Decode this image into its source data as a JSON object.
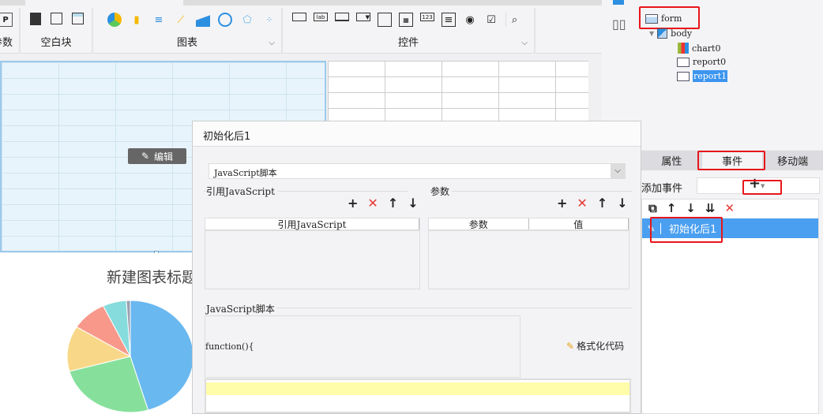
{
  "toolbar": {
    "groups": [
      {
        "label": "参数"
      },
      {
        "label": "空白块"
      },
      {
        "label": "图表"
      },
      {
        "label": "控件"
      }
    ],
    "param_icon": "P"
  },
  "canvas": {
    "edit_button": "编辑",
    "chart_title": "新建图表标题"
  },
  "pie": {
    "slices": [
      {
        "value": 45,
        "color": "#6ab8f0"
      },
      {
        "value": 25,
        "color": "#86e09c"
      },
      {
        "value": 13,
        "color": "#f8d888"
      },
      {
        "value": 9,
        "color": "#f7988a"
      },
      {
        "value": 6,
        "color": "#86dcdc"
      },
      {
        "value": 1,
        "color": "#9aa0b0"
      }
    ]
  },
  "tree": {
    "root": "form",
    "body": "body",
    "children": [
      "chart0",
      "report0",
      "report1"
    ]
  },
  "panel": {
    "tabs": [
      "属性",
      "事件",
      "移动端"
    ],
    "add_event_label": "添加事件",
    "add_symbol": "+",
    "event_item": "初始化后1"
  },
  "dialog": {
    "title": "初始化后1",
    "type_select": "JavaScript脚本",
    "ref_js_section": "引用JavaScript",
    "ref_js_column": "引用JavaScript",
    "params_section": "参数",
    "params_columns": [
      "参数",
      "值"
    ],
    "script_section": "JavaScript脚本",
    "code_header": "function(){",
    "format_button": "格式化代码"
  }
}
